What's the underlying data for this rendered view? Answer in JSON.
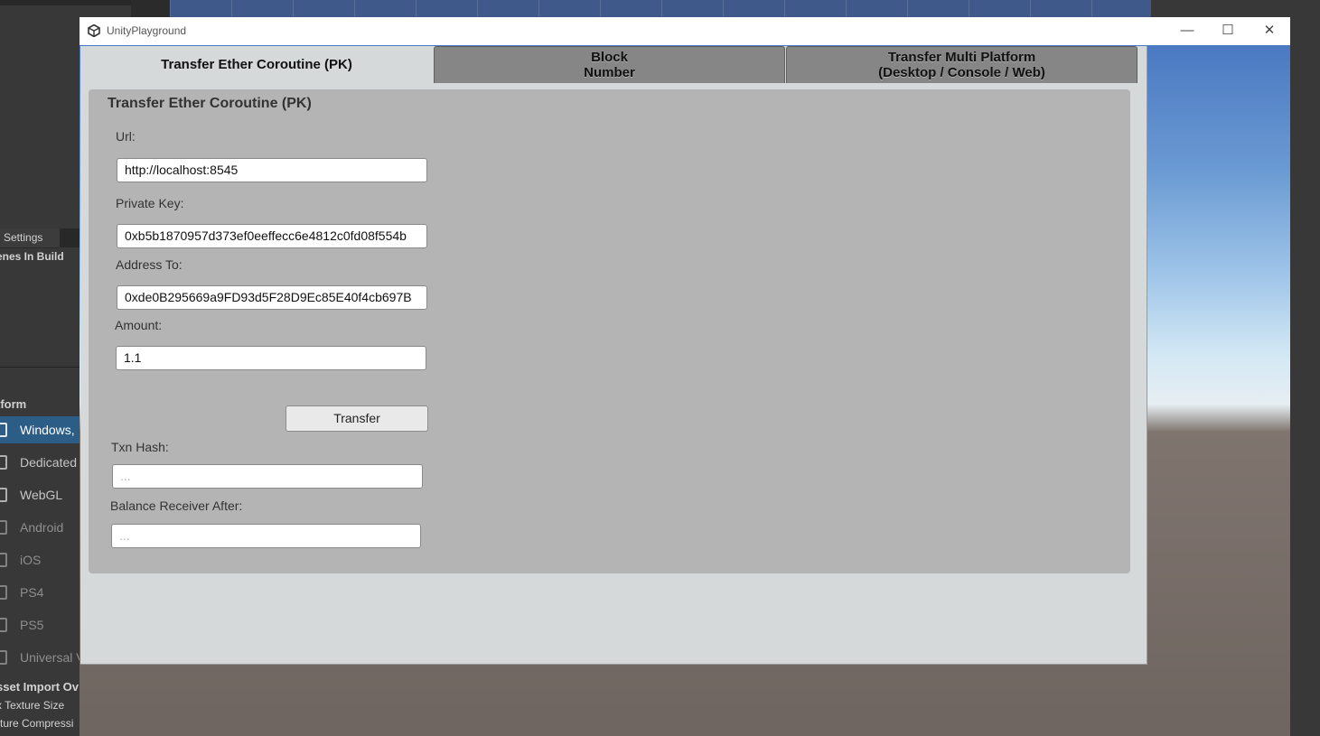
{
  "background": {
    "build_settings_tab": "d Settings",
    "scenes_in_build": "enes In Build",
    "platform_title": "tform",
    "platforms": [
      {
        "label": "Windows,",
        "active": true
      },
      {
        "label": "Dedicated"
      },
      {
        "label": "WebGL"
      },
      {
        "label": "Android"
      },
      {
        "label": "iOS"
      },
      {
        "label": "PS4"
      },
      {
        "label": "PS5"
      },
      {
        "label": "Universal V"
      }
    ],
    "asset_import": "sset Import Ov",
    "texture_size": "x Texture Size",
    "texture_compression": "xture Compressi"
  },
  "window": {
    "title": "UnityPlayground",
    "minimize": "—",
    "maximize": "☐",
    "close": "✕"
  },
  "tabs": [
    {
      "line1": "Transfer Ether Coroutine (PK)",
      "line2": ""
    },
    {
      "line1": "Block",
      "line2": "Number"
    },
    {
      "line1": "Transfer Multi Platform",
      "line2": "(Desktop / Console / Web)"
    }
  ],
  "form": {
    "title": "Transfer Ether Coroutine (PK)",
    "url_label": "Url:",
    "url_value": "http://localhost:8545",
    "pk_label": "Private Key:",
    "pk_value": "0xb5b1870957d373ef0eeffecc6e4812c0fd08f554b",
    "address_label": "Address To:",
    "address_value": "0xde0B295669a9FD93d5F28D9Ec85E40f4cb697B",
    "amount_label": "Amount:",
    "amount_value": "1.1",
    "transfer_button": "Transfer",
    "txn_label": "Txn Hash:",
    "txn_value": "...",
    "balance_label": "Balance Receiver After:",
    "balance_value": "..."
  }
}
